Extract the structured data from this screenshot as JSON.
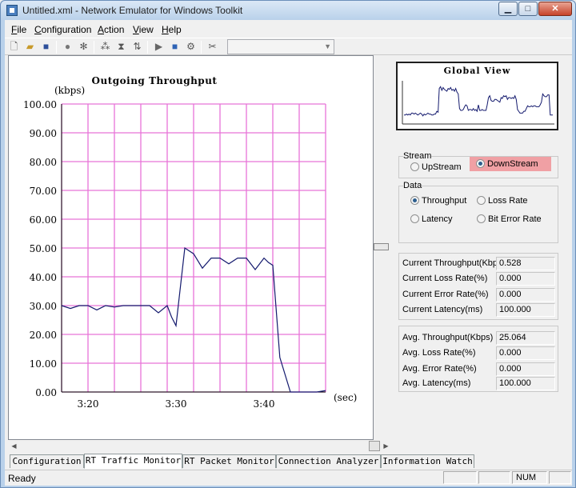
{
  "window": {
    "title": "Untitled.xml - Network Emulator for Windows Toolkit",
    "min_glyph": "▁",
    "max_glyph": "□",
    "close_glyph": "✕"
  },
  "menu": [
    {
      "label": "File",
      "key": "F",
      "rest": "ile"
    },
    {
      "label": "Configuration",
      "key": "C",
      "rest": "onfiguration"
    },
    {
      "label": "Action",
      "key": "A",
      "rest": "ction"
    },
    {
      "label": "View",
      "key": "V",
      "rest": "iew"
    },
    {
      "label": "Help",
      "key": "H",
      "rest": "elp"
    }
  ],
  "toolbar_icons": [
    "new-icon",
    "open-icon",
    "save-icon",
    "record-icon",
    "tools-icon",
    "network-icon",
    "filter-icon",
    "sort-icon",
    "play-icon",
    "stop-icon",
    "settings-icon",
    "disconnect-icon"
  ],
  "toolbar_combo": {
    "value": ""
  },
  "chart_data": {
    "type": "line",
    "title": "Outgoing Throughput",
    "ylabel": "(kbps)",
    "xlabel": "(sec)",
    "ylim": [
      0,
      100
    ],
    "yticks": [
      "100.00",
      "90.00",
      "80.00",
      "70.00",
      "60.00",
      "50.00",
      "40.00",
      "30.00",
      "20.00",
      "10.00",
      "0.00"
    ],
    "xticks": [
      {
        "label": "3:20",
        "t": 20
      },
      {
        "label": "3:30",
        "t": 30
      },
      {
        "label": "3:40",
        "t": 40
      }
    ],
    "xlim": [
      17,
      47
    ],
    "line_color": "#141a6e",
    "grid_color": "#e874d8",
    "series": [
      {
        "x": [
          17,
          18,
          19,
          20,
          21,
          22,
          23,
          24,
          25,
          26,
          27,
          28,
          29,
          29.5,
          30,
          31,
          32,
          33,
          34,
          35,
          36,
          37,
          38,
          39,
          40,
          40.5,
          41,
          41.8,
          43,
          44,
          45,
          46,
          47
        ],
        "values": [
          30,
          29,
          30,
          30,
          28.5,
          30,
          29.5,
          30,
          30,
          30,
          30,
          27.5,
          30,
          26,
          23,
          50,
          48,
          43,
          46.5,
          46.5,
          44.5,
          46.5,
          46.5,
          42.5,
          46.5,
          45,
          44,
          12,
          0,
          0,
          0,
          0,
          0.5
        ]
      }
    ]
  },
  "global_view": {
    "title": "Global View",
    "series": [
      9,
      9,
      10,
      9,
      10,
      9,
      11,
      11,
      10,
      11,
      10,
      9,
      10,
      11,
      10,
      8,
      10,
      9,
      10,
      11,
      10,
      10,
      9,
      9,
      10,
      10,
      13,
      12,
      38,
      40,
      36,
      39,
      37,
      36,
      35,
      38,
      37,
      39,
      36,
      37,
      35,
      38,
      34,
      32,
      16,
      14,
      14,
      15,
      18,
      20,
      19,
      14,
      15,
      15,
      14,
      16,
      14,
      15,
      13,
      20,
      14,
      14,
      15,
      14,
      14,
      14,
      20,
      28,
      30,
      25,
      24,
      24,
      26,
      26,
      25,
      24,
      23,
      28,
      27,
      30,
      29,
      30,
      26,
      28,
      28,
      27,
      28,
      27,
      30,
      26,
      15,
      13,
      11,
      11,
      11,
      13,
      13,
      16,
      19,
      18,
      18,
      19,
      18,
      19,
      19,
      18,
      18,
      18,
      20,
      23,
      32,
      30,
      29,
      29,
      31,
      31,
      9,
      9,
      9
    ]
  },
  "stream": {
    "label": "Stream",
    "options": [
      {
        "label": "UpStream",
        "checked": false
      },
      {
        "label": "DownStream",
        "checked": true
      }
    ]
  },
  "data_group": {
    "label": "Data",
    "options": [
      {
        "label": "Throughput",
        "checked": true
      },
      {
        "label": "Loss Rate",
        "checked": false
      },
      {
        "label": "Latency",
        "checked": false
      },
      {
        "label": "Bit Error Rate",
        "checked": false
      }
    ]
  },
  "current": [
    {
      "label": "Current Throughput(Kbps)",
      "value": "0.528"
    },
    {
      "label": "Current Loss Rate(%)",
      "value": "0.000"
    },
    {
      "label": "Current Error Rate(%)",
      "value": "0.000"
    },
    {
      "label": "Current Latency(ms)",
      "value": "100.000"
    }
  ],
  "average": [
    {
      "label": "Avg. Throughput(Kbps)",
      "value": "25.064"
    },
    {
      "label": "Avg. Loss Rate(%)",
      "value": "0.000"
    },
    {
      "label": "Avg. Error Rate(%)",
      "value": "0.000"
    },
    {
      "label": "Avg. Latency(ms)",
      "value": "100.000"
    }
  ],
  "tabs": [
    {
      "label": "Configuration",
      "active": false
    },
    {
      "label": "RT Traffic Monitor",
      "active": true
    },
    {
      "label": "RT Packet Monitor",
      "active": false
    },
    {
      "label": "Connection Analyzer",
      "active": false
    },
    {
      "label": "Information Watch",
      "active": false
    }
  ],
  "status": {
    "text": "Ready",
    "num": "NUM"
  }
}
